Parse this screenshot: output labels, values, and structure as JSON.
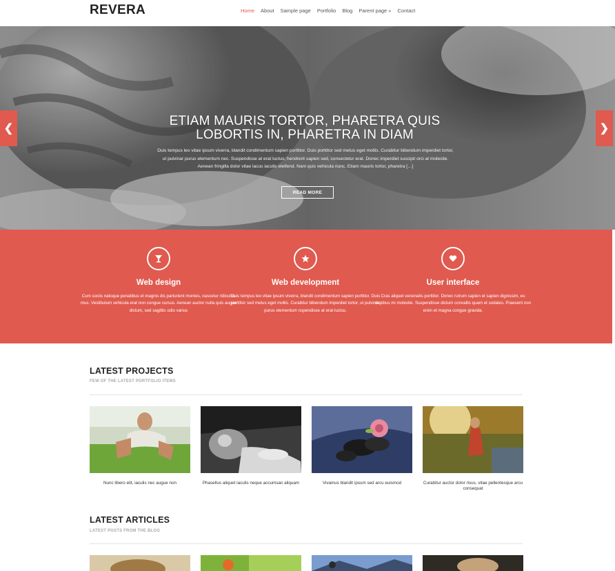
{
  "site": {
    "logo": "REVERA"
  },
  "nav": [
    "Home",
    "About",
    "Sample page",
    "Portfolio",
    "Blog",
    "Parent page »",
    "Contact"
  ],
  "colors": {
    "accent": "#e05a4f"
  },
  "hero": {
    "title": "ETIAM MAURIS TORTOR, PHARETRA QUIS LOBORTIS IN, PHARETRA IN DIAM",
    "text": "Duis tempus leo vitae ipsum viverra, blandit condimentum sapien porttitor. Duis porttitor sed metus eget mollis. Curabitur bibendum imperdiet tortor, ut pulvinar purus elementum nec. Suspendisse at erat luctus; hendrerit sapien sed, consectetur erat. Donec imperdiet suscipit orci at molestie. Aenean fringilla dolor vitae lacus iaculis eleifend. Nam quis vehicula nunc. Etiam mauris tortor, pharetra […]",
    "button": "READ MORE",
    "prev_icon": "chevron-left-icon",
    "next_icon": "chevron-right-icon"
  },
  "features": [
    {
      "icon": "glass-icon",
      "title": "Web design",
      "text": "Cum sociis natoque penatibus et magnis dis parturient montes, nascetur ridiculus mus. Vestibulum vehicula erat non congue cursus. Aenean auctor nulla quis augue dictum, sed sagittis odio varius"
    },
    {
      "icon": "star-icon",
      "title": "Web development",
      "text": "Duis tempus leo vitae ipsum viverra, blandit condimentum sapien porttitor. Duis porttitor sed metus eget mollis. Curabitur bibendum imperdiet tortor, ut pulvinar purus elementum nspendisse at erat luctus."
    },
    {
      "icon": "heart-icon",
      "title": "User interface",
      "text": "Cras aliquet venenatis porttitor. Donec rutrum sapien et sapien dignissim, eu dapibus mi molestie. Suspendisse dictum convallis quam et sodales. Praesent non enim et magna congue gravida."
    }
  ],
  "projects": {
    "title": "LATEST PROJECTS",
    "subtitle": "FEW OF THE LATEST PORTFOLIO ITEMS",
    "items": [
      {
        "caption": "Nunc libero elit, iaculis nec augue non"
      },
      {
        "caption": "Phasellus aliquet iaculis neque accumsan aliquam"
      },
      {
        "caption": "Vivamus blandit ipsum sed arcu euismod"
      },
      {
        "caption": "Curabitur auctor dolor risus, vitae pellentesque arcu consequat"
      }
    ]
  },
  "articles": {
    "title": "LATEST ARTICLES",
    "subtitle": "LATEST POSTS FROM THE BLOG"
  }
}
